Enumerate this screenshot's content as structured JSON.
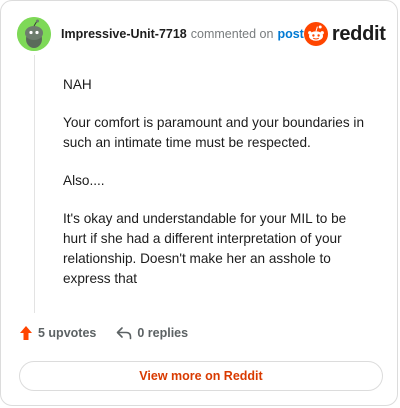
{
  "header": {
    "username": "Impressive-Unit-7718",
    "action_text": "commented on",
    "post_link": "post",
    "brand": "reddit"
  },
  "comment": {
    "paragraphs": [
      "NAH",
      "Your comfort is paramount and your boundaries in such an intimate time must be respected.",
      "Also....",
      "It's okay and understandable for your MIL to be hurt if she had a different interpretation of your relationship. Doesn't make her an asshole to express that"
    ]
  },
  "actions": {
    "upvotes": "5 upvotes",
    "replies": "0 replies"
  },
  "view_more": {
    "label": "View more on Reddit"
  },
  "colors": {
    "avatar_bg": "#7ed957",
    "accent_orange": "#ff4500",
    "link_blue": "#0079d3",
    "button_text": "#d93a00"
  }
}
